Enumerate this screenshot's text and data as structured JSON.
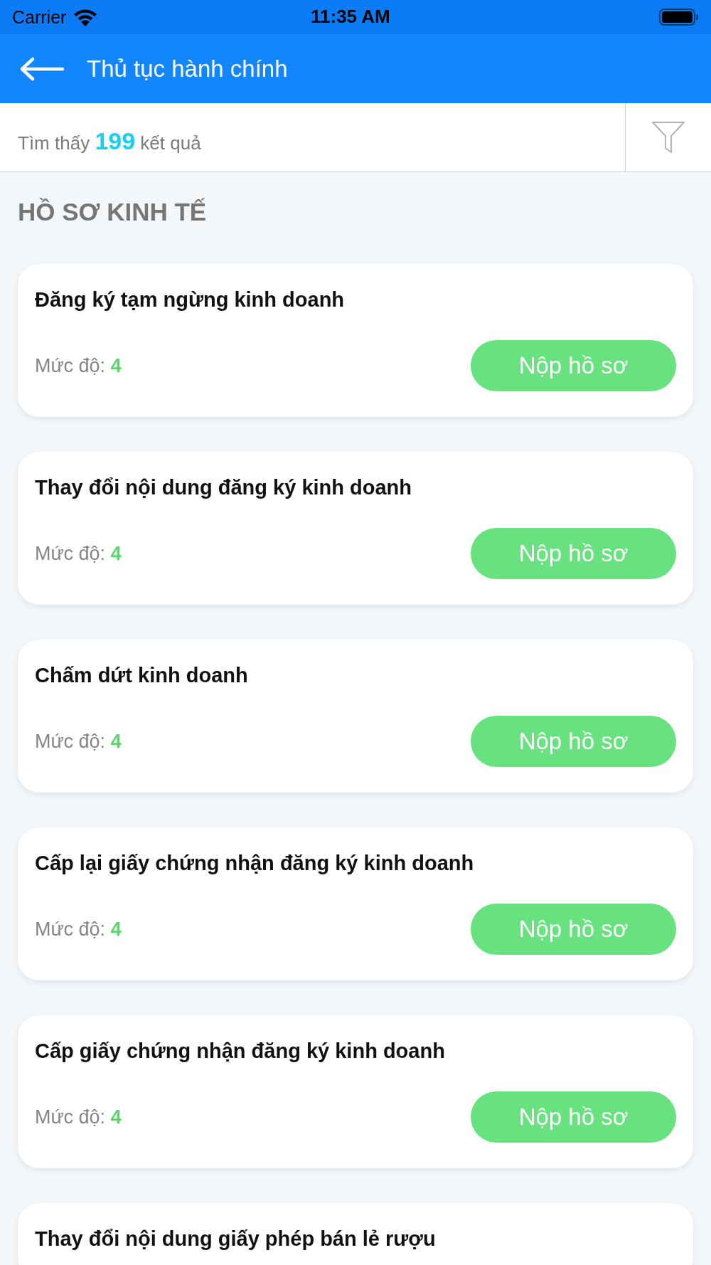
{
  "status_bar": {
    "carrier": "Carrier",
    "time": "11:35 AM"
  },
  "header": {
    "title": "Thủ tục hành chính"
  },
  "results": {
    "prefix": "Tìm thấy",
    "count": "199",
    "suffix": "kết quả"
  },
  "section": {
    "title": "HỒ SƠ KINH TẾ"
  },
  "procedures": [
    {
      "title": "Đăng ký tạm ngừng kinh doanh",
      "level_label": "Mức độ:",
      "level_value": "4",
      "button": "Nộp hồ sơ"
    },
    {
      "title": "Thay đổi nội dung đăng ký kinh doanh",
      "level_label": "Mức độ:",
      "level_value": "4",
      "button": "Nộp hồ sơ"
    },
    {
      "title": "Chấm dứt kinh doanh",
      "level_label": "Mức độ:",
      "level_value": "4",
      "button": "Nộp hồ sơ"
    },
    {
      "title": "Cấp lại giấy chứng nhận đăng ký kinh doanh",
      "level_label": "Mức độ:",
      "level_value": "4",
      "button": "Nộp hồ sơ"
    },
    {
      "title": "Cấp giấy chứng nhận đăng ký kinh doanh",
      "level_label": "Mức độ:",
      "level_value": "4",
      "button": "Nộp hồ sơ"
    },
    {
      "title": "Thay đổi nội dung giấy phép bán lẻ rượu"
    }
  ]
}
